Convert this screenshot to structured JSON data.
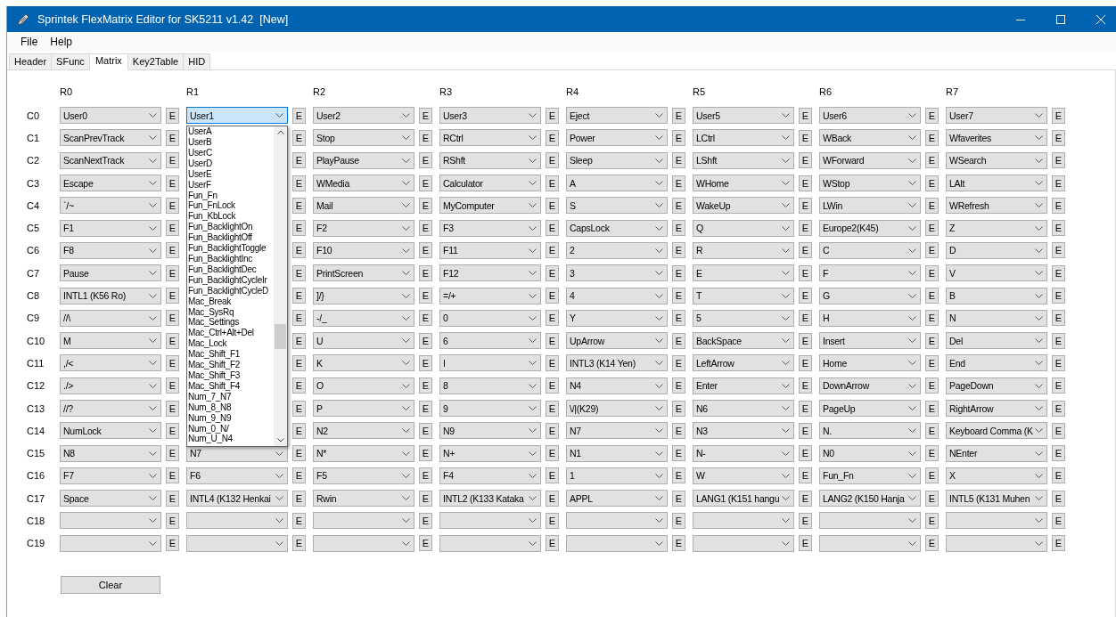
{
  "window": {
    "title": "Sprintek FlexMatrix Editor for SK5211 v1.42  [New]"
  },
  "menu": [
    "File",
    "Help"
  ],
  "tabs": [
    {
      "label": "Header",
      "selected": false
    },
    {
      "label": "SFunc",
      "selected": false
    },
    {
      "label": "Matrix",
      "selected": true
    },
    {
      "label": "Key2Table",
      "selected": false
    },
    {
      "label": "HID",
      "selected": false
    }
  ],
  "column_headers": [
    "R0",
    "R1",
    "R2",
    "R3",
    "R4",
    "R5",
    "R6",
    "R7"
  ],
  "dropdown_items": [
    "UserA",
    "UserB",
    "UserC",
    "UserD",
    "UserE",
    "UserF",
    "Fun_Fn",
    "Fun_FnLock",
    "Fun_KbLock",
    "Fun_BacklightOn",
    "Fun_BacklightOff",
    "Fun_BacklightToggle",
    "Fun_BacklightInc",
    "Fun_BacklightDec",
    "Fun_BacklightCycleIr",
    "Fun_BacklightCycleD",
    "Mac_Break",
    "Mac_SysRq",
    "Mac_Settings",
    "Mac_Ctrl+Alt+Del",
    "Mac_Lock",
    "Mac_Shift_F1",
    "Mac_Shift_F2",
    "Mac_Shift_F3",
    "Mac_Shift_F4",
    "Num_7_N7",
    "Num_8_N8",
    "Num_9_N9",
    "Num_0_N/",
    "Num_U_N4"
  ],
  "rows": [
    {
      "label": "C0",
      "cells": [
        {
          "kind": "combo",
          "value": "User0",
          "button": "E"
        },
        {
          "kind": "open_combo",
          "value": "User1",
          "button": "E"
        },
        {
          "kind": "combo",
          "value": "User2",
          "button": "E"
        },
        {
          "kind": "combo",
          "value": "User3",
          "button": "E"
        },
        {
          "kind": "combo",
          "value": "Eject",
          "button": "E"
        },
        {
          "kind": "combo",
          "value": "User5",
          "button": "E"
        },
        {
          "kind": "combo",
          "value": "User6",
          "button": "E"
        },
        {
          "kind": "combo",
          "value": "User7",
          "button": "E"
        }
      ]
    },
    {
      "label": "C1",
      "cells": [
        {
          "kind": "combo",
          "value": "ScanPrevTrack",
          "button": "E"
        },
        {
          "kind": "covered",
          "button": "E"
        },
        {
          "kind": "combo",
          "value": "Stop",
          "button": "E"
        },
        {
          "kind": "combo",
          "value": "RCtrl",
          "button": "E"
        },
        {
          "kind": "combo",
          "value": "Power",
          "button": "E"
        },
        {
          "kind": "combo",
          "value": "LCtrl",
          "button": "E"
        },
        {
          "kind": "combo",
          "value": "WBack",
          "button": "E"
        },
        {
          "kind": "combo",
          "value": "Wfaverites",
          "button": "E"
        }
      ]
    },
    {
      "label": "C2",
      "cells": [
        {
          "kind": "combo",
          "value": "ScanNextTrack",
          "button": "E"
        },
        {
          "kind": "covered",
          "button": "E"
        },
        {
          "kind": "combo",
          "value": "PlayPause",
          "button": "E"
        },
        {
          "kind": "combo",
          "value": "RShft",
          "button": "E"
        },
        {
          "kind": "combo",
          "value": "Sleep",
          "button": "E"
        },
        {
          "kind": "combo",
          "value": "LShft",
          "button": "E"
        },
        {
          "kind": "combo",
          "value": "WForward",
          "button": "E"
        },
        {
          "kind": "combo",
          "value": "WSearch",
          "button": "E"
        }
      ]
    },
    {
      "label": "C3",
      "cells": [
        {
          "kind": "combo",
          "value": "Escape",
          "button": "E"
        },
        {
          "kind": "covered",
          "button": "E"
        },
        {
          "kind": "combo",
          "value": "WMedia",
          "button": "E"
        },
        {
          "kind": "combo",
          "value": "Calculator",
          "button": "E"
        },
        {
          "kind": "combo",
          "value": "A",
          "button": "E"
        },
        {
          "kind": "combo",
          "value": "WHome",
          "button": "E"
        },
        {
          "kind": "combo",
          "value": "WStop",
          "button": "E"
        },
        {
          "kind": "combo",
          "value": "LAlt",
          "button": "E"
        }
      ]
    },
    {
      "label": "C4",
      "cells": [
        {
          "kind": "combo",
          "value": "`/~",
          "button": "E"
        },
        {
          "kind": "covered",
          "button": "E"
        },
        {
          "kind": "combo",
          "value": "Mail",
          "button": "E"
        },
        {
          "kind": "combo",
          "value": "MyComputer",
          "button": "E"
        },
        {
          "kind": "combo",
          "value": "S",
          "button": "E"
        },
        {
          "kind": "combo",
          "value": "WakeUp",
          "button": "E"
        },
        {
          "kind": "combo",
          "value": "LWin",
          "button": "E"
        },
        {
          "kind": "combo",
          "value": "WRefresh",
          "button": "E"
        }
      ]
    },
    {
      "label": "C5",
      "cells": [
        {
          "kind": "combo",
          "value": "F1",
          "button": "E"
        },
        {
          "kind": "covered",
          "button": "E"
        },
        {
          "kind": "combo",
          "value": "F2",
          "button": "E"
        },
        {
          "kind": "combo",
          "value": "F3",
          "button": "E"
        },
        {
          "kind": "combo",
          "value": "CapsLock",
          "button": "E"
        },
        {
          "kind": "combo",
          "value": "Q",
          "button": "E"
        },
        {
          "kind": "combo",
          "value": "Europe2(K45)",
          "button": "E"
        },
        {
          "kind": "combo",
          "value": "Z",
          "button": "E"
        }
      ]
    },
    {
      "label": "C6",
      "cells": [
        {
          "kind": "combo",
          "value": "F8",
          "button": "E"
        },
        {
          "kind": "covered",
          "button": "E"
        },
        {
          "kind": "combo",
          "value": "F10",
          "button": "E"
        },
        {
          "kind": "combo",
          "value": "F11",
          "button": "E"
        },
        {
          "kind": "combo",
          "value": "2",
          "button": "E"
        },
        {
          "kind": "combo",
          "value": "R",
          "button": "E"
        },
        {
          "kind": "combo",
          "value": "C",
          "button": "E"
        },
        {
          "kind": "combo",
          "value": "D",
          "button": "E"
        }
      ]
    },
    {
      "label": "C7",
      "cells": [
        {
          "kind": "combo",
          "value": "Pause",
          "button": "E"
        },
        {
          "kind": "covered",
          "button": "E"
        },
        {
          "kind": "combo",
          "value": "PrintScreen",
          "button": "E"
        },
        {
          "kind": "combo",
          "value": "F12",
          "button": "E"
        },
        {
          "kind": "combo",
          "value": "3",
          "button": "E"
        },
        {
          "kind": "combo",
          "value": "E",
          "button": "E"
        },
        {
          "kind": "combo",
          "value": "F",
          "button": "E"
        },
        {
          "kind": "combo",
          "value": "V",
          "button": "E"
        }
      ]
    },
    {
      "label": "C8",
      "cells": [
        {
          "kind": "combo",
          "value": "INTL1 (K56 Ro)",
          "button": "E"
        },
        {
          "kind": "covered",
          "button": "E"
        },
        {
          "kind": "combo",
          "value": "]/}",
          "button": "E"
        },
        {
          "kind": "combo",
          "value": "=/+",
          "button": "E"
        },
        {
          "kind": "combo",
          "value": "4",
          "button": "E"
        },
        {
          "kind": "combo",
          "value": "T",
          "button": "E"
        },
        {
          "kind": "combo",
          "value": "G",
          "button": "E"
        },
        {
          "kind": "combo",
          "value": "B",
          "button": "E"
        }
      ]
    },
    {
      "label": "C9",
      "cells": [
        {
          "kind": "combo",
          "value": "//\\",
          "button": "E"
        },
        {
          "kind": "covered",
          "button": "E"
        },
        {
          "kind": "combo",
          "value": "-/_",
          "button": "E"
        },
        {
          "kind": "combo",
          "value": "0",
          "button": "E"
        },
        {
          "kind": "combo",
          "value": "Y",
          "button": "E"
        },
        {
          "kind": "combo",
          "value": "5",
          "button": "E"
        },
        {
          "kind": "combo",
          "value": "H",
          "button": "E"
        },
        {
          "kind": "combo",
          "value": "N",
          "button": "E"
        }
      ]
    },
    {
      "label": "C10",
      "cells": [
        {
          "kind": "combo",
          "value": "M",
          "button": "E"
        },
        {
          "kind": "covered",
          "button": "E"
        },
        {
          "kind": "combo",
          "value": "U",
          "button": "E"
        },
        {
          "kind": "combo",
          "value": "6",
          "button": "E"
        },
        {
          "kind": "combo",
          "value": "UpArrow",
          "button": "E"
        },
        {
          "kind": "combo",
          "value": "BackSpace",
          "button": "E"
        },
        {
          "kind": "combo",
          "value": "Insert",
          "button": "E"
        },
        {
          "kind": "combo",
          "value": "Del",
          "button": "E"
        }
      ]
    },
    {
      "label": "C11",
      "cells": [
        {
          "kind": "combo",
          "value": ",/<",
          "button": "E"
        },
        {
          "kind": "covered",
          "button": "E"
        },
        {
          "kind": "combo",
          "value": "K",
          "button": "E"
        },
        {
          "kind": "combo",
          "value": "I",
          "button": "E"
        },
        {
          "kind": "combo",
          "value": "INTL3 (K14 Yen)",
          "button": "E"
        },
        {
          "kind": "combo",
          "value": "LeftArrow",
          "button": "E"
        },
        {
          "kind": "combo",
          "value": "Home",
          "button": "E"
        },
        {
          "kind": "combo",
          "value": "End",
          "button": "E"
        }
      ]
    },
    {
      "label": "C12",
      "cells": [
        {
          "kind": "combo",
          "value": "./>",
          "button": "E"
        },
        {
          "kind": "covered",
          "button": "E"
        },
        {
          "kind": "combo",
          "value": "O",
          "button": "E"
        },
        {
          "kind": "combo",
          "value": "8",
          "button": "E"
        },
        {
          "kind": "combo",
          "value": "N4",
          "button": "E"
        },
        {
          "kind": "combo",
          "value": "Enter",
          "button": "E"
        },
        {
          "kind": "combo",
          "value": "DownArrow",
          "button": "E"
        },
        {
          "kind": "combo",
          "value": "PageDown",
          "button": "E"
        }
      ]
    },
    {
      "label": "C13",
      "cells": [
        {
          "kind": "combo",
          "value": "//?",
          "button": "E"
        },
        {
          "kind": "covered",
          "button": "E"
        },
        {
          "kind": "combo",
          "value": "P",
          "button": "E"
        },
        {
          "kind": "combo",
          "value": "9",
          "button": "E"
        },
        {
          "kind": "combo",
          "value": "\\/|(K29)",
          "button": "E"
        },
        {
          "kind": "combo",
          "value": "N6",
          "button": "E"
        },
        {
          "kind": "combo",
          "value": "PageUp",
          "button": "E"
        },
        {
          "kind": "combo",
          "value": "RightArrow",
          "button": "E"
        }
      ]
    },
    {
      "label": "C14",
      "cells": [
        {
          "kind": "combo",
          "value": "NumLock",
          "button": "E"
        },
        {
          "kind": "covered",
          "button": "E"
        },
        {
          "kind": "combo",
          "value": "N2",
          "button": "E"
        },
        {
          "kind": "combo",
          "value": "N9",
          "button": "E"
        },
        {
          "kind": "combo",
          "value": "N7",
          "button": "E"
        },
        {
          "kind": "combo",
          "value": "N3",
          "button": "E"
        },
        {
          "kind": "combo",
          "value": "N.",
          "button": "E"
        },
        {
          "kind": "combo",
          "value": "Keyboard Comma (K",
          "button": "E"
        }
      ]
    },
    {
      "label": "C15",
      "cells": [
        {
          "kind": "combo",
          "value": "N8",
          "button": "E"
        },
        {
          "kind": "combo",
          "value": "N7",
          "button": "E"
        },
        {
          "kind": "combo",
          "value": "N*",
          "button": "E"
        },
        {
          "kind": "combo",
          "value": "N+",
          "button": "E"
        },
        {
          "kind": "combo",
          "value": "N1",
          "button": "E"
        },
        {
          "kind": "combo",
          "value": "N-",
          "button": "E"
        },
        {
          "kind": "combo",
          "value": "N0",
          "button": "E"
        },
        {
          "kind": "combo",
          "value": "NEnter",
          "button": "E"
        }
      ]
    },
    {
      "label": "C16",
      "cells": [
        {
          "kind": "combo",
          "value": "F7",
          "button": "E"
        },
        {
          "kind": "combo",
          "value": "F6",
          "button": "E"
        },
        {
          "kind": "combo",
          "value": "F5",
          "button": "E"
        },
        {
          "kind": "combo",
          "value": "F4",
          "button": "E"
        },
        {
          "kind": "combo",
          "value": "1",
          "button": "E"
        },
        {
          "kind": "combo",
          "value": "W",
          "button": "E"
        },
        {
          "kind": "combo",
          "value": "Fun_Fn",
          "button": "E"
        },
        {
          "kind": "combo",
          "value": "X",
          "button": "E"
        }
      ]
    },
    {
      "label": "C17",
      "cells": [
        {
          "kind": "combo",
          "value": "Space",
          "button": "E"
        },
        {
          "kind": "combo",
          "value": "INTL4 (K132 Henkai",
          "button": "E"
        },
        {
          "kind": "combo",
          "value": "Rwin",
          "button": "E"
        },
        {
          "kind": "combo",
          "value": "INTL2 (K133 Kataka",
          "button": "E"
        },
        {
          "kind": "combo",
          "value": "APPL",
          "button": "E"
        },
        {
          "kind": "combo",
          "value": "LANG1 (K151 hangu",
          "button": "E"
        },
        {
          "kind": "combo",
          "value": "LANG2 (K150 Hanja",
          "button": "E"
        },
        {
          "kind": "combo",
          "value": "INTL5 (K131 Muhen",
          "button": "E"
        }
      ]
    },
    {
      "label": "C18",
      "cells": [
        {
          "kind": "combo",
          "button": "E"
        },
        {
          "kind": "combo",
          "button": "E"
        },
        {
          "kind": "combo",
          "button": "E"
        },
        {
          "kind": "combo",
          "button": "E"
        },
        {
          "kind": "combo",
          "button": "E"
        },
        {
          "kind": "combo",
          "button": "E"
        },
        {
          "kind": "combo",
          "button": "E"
        },
        {
          "kind": "combo",
          "button": "E"
        }
      ]
    },
    {
      "label": "C19",
      "cells": [
        {
          "kind": "combo",
          "button": "E"
        },
        {
          "kind": "combo",
          "button": "E"
        },
        {
          "kind": "combo",
          "button": "E"
        },
        {
          "kind": "combo",
          "button": "E"
        },
        {
          "kind": "combo",
          "button": "E"
        },
        {
          "kind": "combo",
          "button": "E"
        },
        {
          "kind": "combo",
          "button": "E"
        },
        {
          "kind": "combo",
          "button": "E"
        }
      ]
    }
  ],
  "clear_button": "Clear"
}
